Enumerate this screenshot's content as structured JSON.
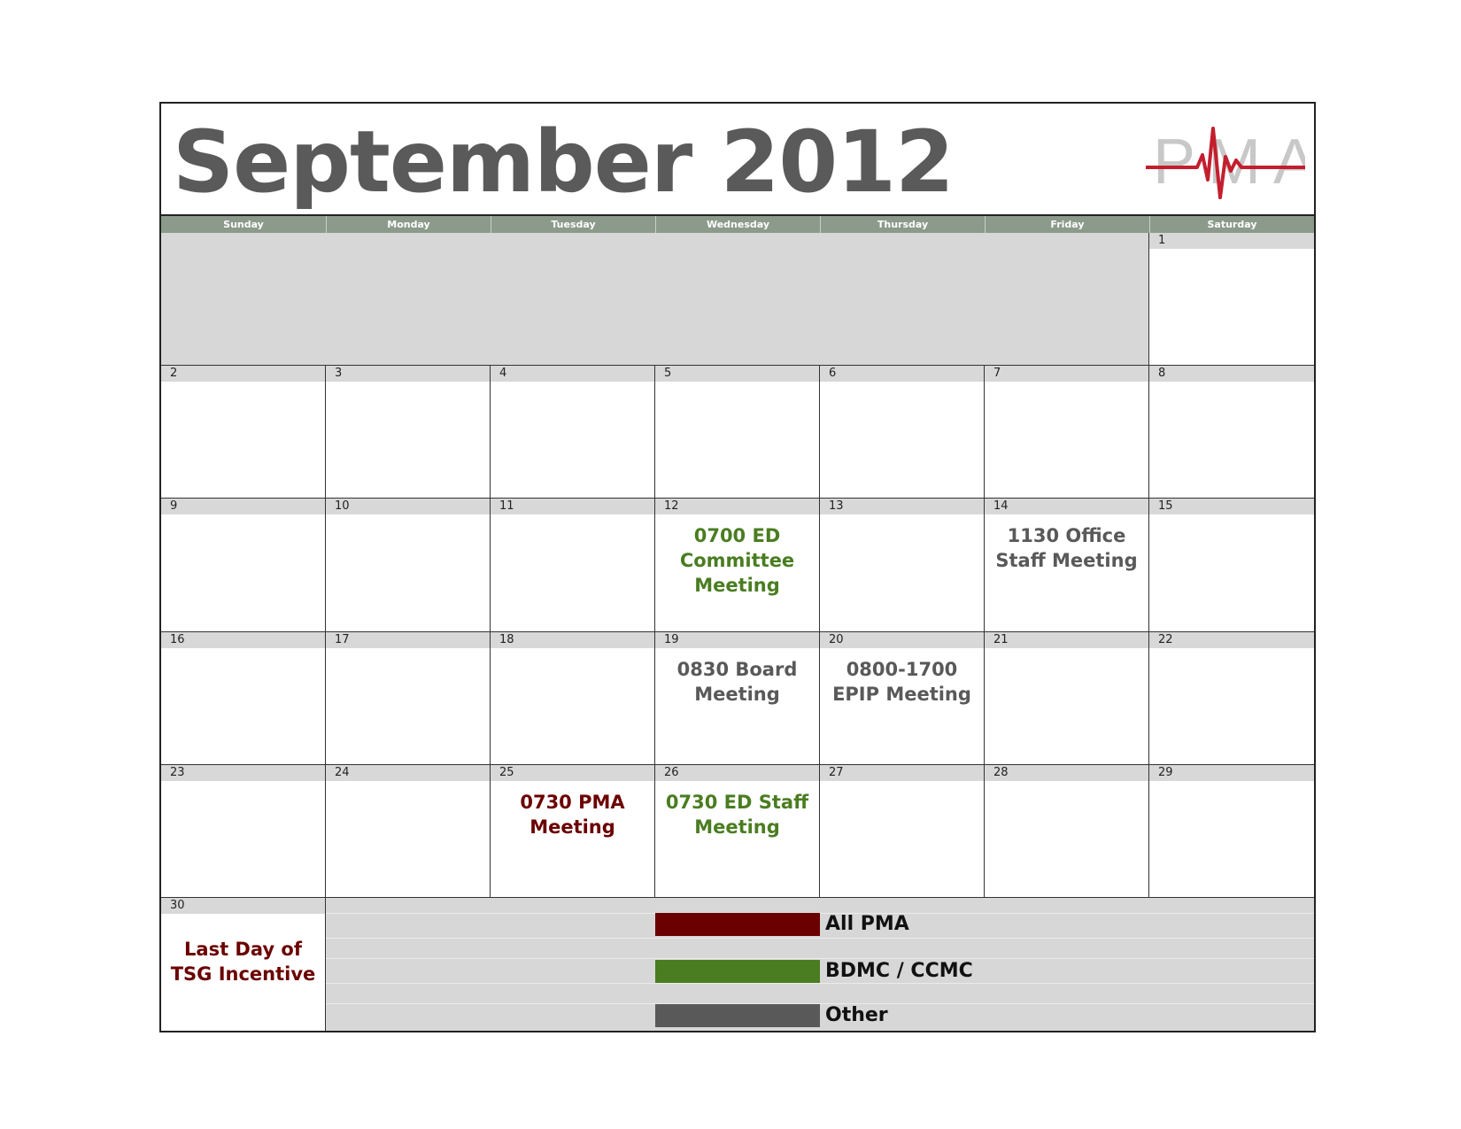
{
  "title": "September 2012",
  "logo_text": "PMA",
  "colors": {
    "all_pma": "#6b0000",
    "bdmc_ccmc": "#4a7d21",
    "other": "#595959"
  },
  "weekdays": [
    "Sunday",
    "Monday",
    "Tuesday",
    "Wednesday",
    "Thursday",
    "Friday",
    "Saturday"
  ],
  "days": {
    "d1": "1",
    "d2": "2",
    "d3": "3",
    "d4": "4",
    "d5": "5",
    "d6": "6",
    "d7": "7",
    "d8": "8",
    "d9": "9",
    "d10": "10",
    "d11": "11",
    "d12": "12",
    "d13": "13",
    "d14": "14",
    "d15": "15",
    "d16": "16",
    "d17": "17",
    "d18": "18",
    "d19": "19",
    "d20": "20",
    "d21": "21",
    "d22": "22",
    "d23": "23",
    "d24": "24",
    "d25": "25",
    "d26": "26",
    "d27": "27",
    "d28": "28",
    "d29": "29",
    "d30": "30"
  },
  "events": {
    "e12": {
      "text": "0700 ED Committee Meeting",
      "category": "bdmc_ccmc"
    },
    "e14": {
      "text": "1130 Office Staff Meeting",
      "category": "other"
    },
    "e19": {
      "text": "0830 Board Meeting",
      "category": "other"
    },
    "e20": {
      "text": "0800-1700 EPIP Meeting",
      "category": "other"
    },
    "e25": {
      "text": "0730 PMA Meeting",
      "category": "all_pma"
    },
    "e26": {
      "text": "0730 ED Staff Meeting",
      "category": "bdmc_ccmc"
    },
    "e30": {
      "text": "Last Day of TSG Incentive",
      "category": "all_pma"
    }
  },
  "legend": [
    {
      "label": "All PMA",
      "category": "all_pma"
    },
    {
      "label": "BDMC / CCMC",
      "category": "bdmc_ccmc"
    },
    {
      "label": "Other",
      "category": "other"
    }
  ]
}
